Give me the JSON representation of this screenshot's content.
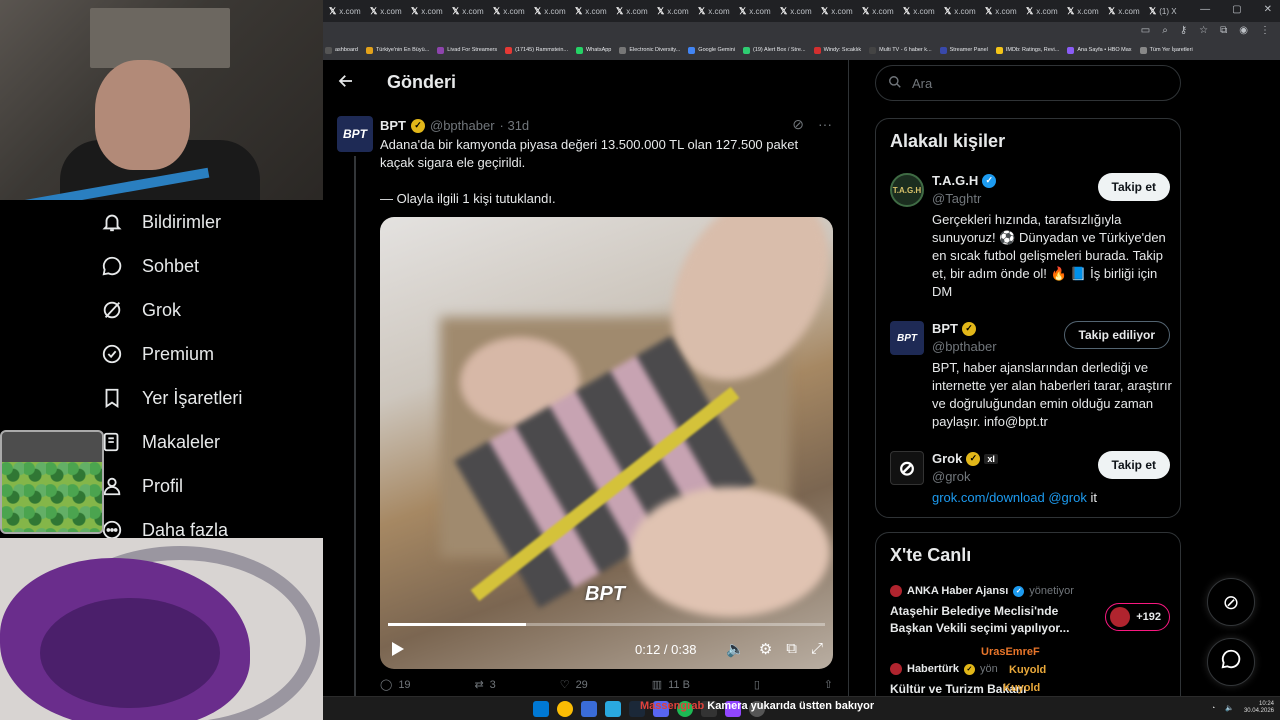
{
  "nav": {
    "items": [
      {
        "label": "Bildirimler",
        "icon": "bell-icon"
      },
      {
        "label": "Sohbet",
        "icon": "chat-icon"
      },
      {
        "label": "Grok",
        "icon": "grok-icon"
      },
      {
        "label": "Premium",
        "icon": "premium-icon"
      },
      {
        "label": "Yer İşaretleri",
        "icon": "bookmark-icon"
      },
      {
        "label": "Makaleler",
        "icon": "article-icon"
      },
      {
        "label": "Profil",
        "icon": "profile-icon"
      },
      {
        "label": "Daha fazla",
        "icon": "more-icon"
      }
    ]
  },
  "browser": {
    "tabs": [
      "x.com",
      "x.com",
      "x.com",
      "x.com",
      "x.com",
      "x.com",
      "x.com",
      "x.com",
      "x.com",
      "x.com",
      "x.com",
      "x.com",
      "x.com",
      "x.com",
      "x.com",
      "x.com",
      "x.com",
      "x.com",
      "x.com",
      "x.com",
      "(1) X"
    ],
    "bookmarks": [
      {
        "label": "ashboard",
        "color": "#555"
      },
      {
        "label": "Türkiye'nin En Büyü...",
        "color": "#e3a21a"
      },
      {
        "label": "Livad For Streamers",
        "color": "#8e44ad"
      },
      {
        "label": "(17145) Rammstein...",
        "color": "#e53935"
      },
      {
        "label": "WhatsApp",
        "color": "#25d366"
      },
      {
        "label": "Electronic Diversity...",
        "color": "#777"
      },
      {
        "label": "Google Gemini",
        "color": "#4285f4"
      },
      {
        "label": "(19) Alert Box / Stre...",
        "color": "#2ecc71"
      },
      {
        "label": "Windy: Sıcaklık",
        "color": "#d32f2f"
      },
      {
        "label": "Multi TV - 6 haber k...",
        "color": "#444"
      },
      {
        "label": "Streamer Panel",
        "color": "#3949ab"
      },
      {
        "label": "IMDb: Ratings, Revi...",
        "color": "#f5c518"
      },
      {
        "label": "Ana Sayfa • HBO Max",
        "color": "#8a5cf6"
      },
      {
        "label": "Tüm Yer İşaretleri",
        "color": "#888"
      }
    ]
  },
  "header": {
    "title": "Gönderi"
  },
  "post": {
    "avatar_text": "BPT",
    "name": "BPT",
    "handle": "@bpthaber",
    "time": "· 31d",
    "text1": "Adana'da bir kamyonda piyasa değeri 13.500.000 TL olan 127.500 paket kaçak sigara ele geçirildi.",
    "text2": "— Olayla ilgili 1 kişi tutuklandı.",
    "video": {
      "watermark": "BPT",
      "current": "0:12",
      "duration": "0:38",
      "time_display": "0:12 / 0:38",
      "progress": 0.316
    },
    "actions": {
      "replies": "19",
      "reposts": "3",
      "likes": "29",
      "views": "11 B"
    }
  },
  "search": {
    "placeholder": "Ara"
  },
  "related": {
    "title": "Alakalı kişiler",
    "people": [
      {
        "avatar": "T.A.G.H",
        "name": "T.A.G.H",
        "handle": "@Taghtr",
        "badge": "blue",
        "bio": "Gerçekleri hızında, tarafsızlığıyla sunuyoruz! ⚽ Dünyadan ve Türkiye'den en sıcak futbol gelişmeleri burada. Takip et, bir adım önde ol! 🔥 📘 İş birliği için DM",
        "button": "Takip et"
      },
      {
        "avatar": "BPT",
        "name": "BPT",
        "handle": "@bpthaber",
        "badge": "gold",
        "bio": "BPT, haber ajanslarından derlediği ve internette yer alan haberleri tarar, araştırır ve doğruluğundan emin olduğu zaman paylaşır. info@bpt.tr",
        "button": "Takip ediliyor"
      },
      {
        "avatar": "⊘",
        "name": "Grok",
        "handle": "@grok",
        "badge": "gold",
        "bio_link": "grok.com/download @grok",
        "bio_tail": " it",
        "button": "Takip et"
      }
    ]
  },
  "live": {
    "title": "X'te Canlı",
    "items": [
      {
        "host": "ANKA Haber Ajansı",
        "role": "yönetiyor",
        "title": "Ataşehir Belediye Meclisi'nde Başkan Vekili seçimi yapılıyor...",
        "count": "+192"
      },
      {
        "host": "Habertürk",
        "role": "yön",
        "title": "Kültür ve Turizm Bakanı",
        "count": ""
      }
    ]
  },
  "overlay": {
    "chat_users": [
      "UrasEmreF",
      "Kuyold",
      "Kuyold"
    ],
    "ticker_user": "Massengrab",
    "ticker_text": "Kamera yukarıda üstten bakıyor"
  },
  "taskbar": {
    "time": "10:24",
    "date": "30.04.2026"
  },
  "colors": {
    "accent": "#1d9bf0",
    "gold": "#e2b719",
    "live": "#f91880"
  }
}
